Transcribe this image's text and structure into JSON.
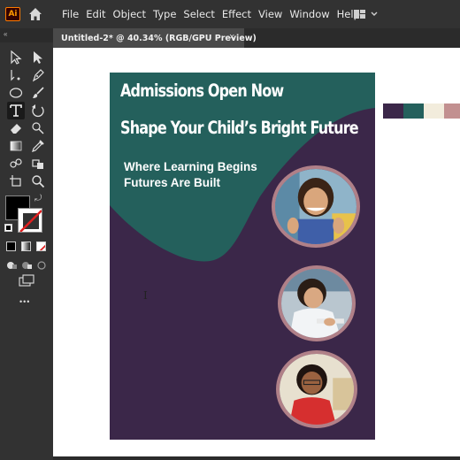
{
  "app": {
    "logo_text": "Ai"
  },
  "menu": [
    "File",
    "Edit",
    "Object",
    "Type",
    "Select",
    "Effect",
    "View",
    "Window",
    "Help"
  ],
  "collapse_glyph": "«",
  "document_tab": {
    "title": "Untitled-2* @ 40.34% (RGB/GPU Preview)",
    "close_glyph": "×"
  },
  "toolbar": {
    "tools": [
      "selection-tool",
      "direct-selection-tool",
      "magic-wand-tool",
      "pen-tool",
      "ellipse-tool",
      "paintbrush-tool",
      "type-tool",
      "rotate-tool",
      "eraser-tool",
      "lasso-tool",
      "gradient-tool",
      "eyedropper-tool",
      "shape-builder-tool",
      "live-paint-tool",
      "artboard-tool",
      "zoom-tool"
    ],
    "active_tool": "type-tool",
    "fill_color": "#000000",
    "stroke_color": "none",
    "more_glyph": "•••"
  },
  "poster": {
    "headline_line1": "Admissions Open Now",
    "headline_line2": "Shape Your Child’s Bright Future",
    "subline1": "Where Learning Begins",
    "subline2": "Futures Are Built",
    "background_color": "#3b2749",
    "shape_color": "#24605c",
    "frame_color": "#b08088",
    "photos": [
      "child-photo-thumbs-up",
      "child-photo-writing",
      "child-photo-red-shirt"
    ]
  },
  "swatches": [
    "#3b2749",
    "#24605c",
    "#f2ecdc",
    "#c29090"
  ]
}
